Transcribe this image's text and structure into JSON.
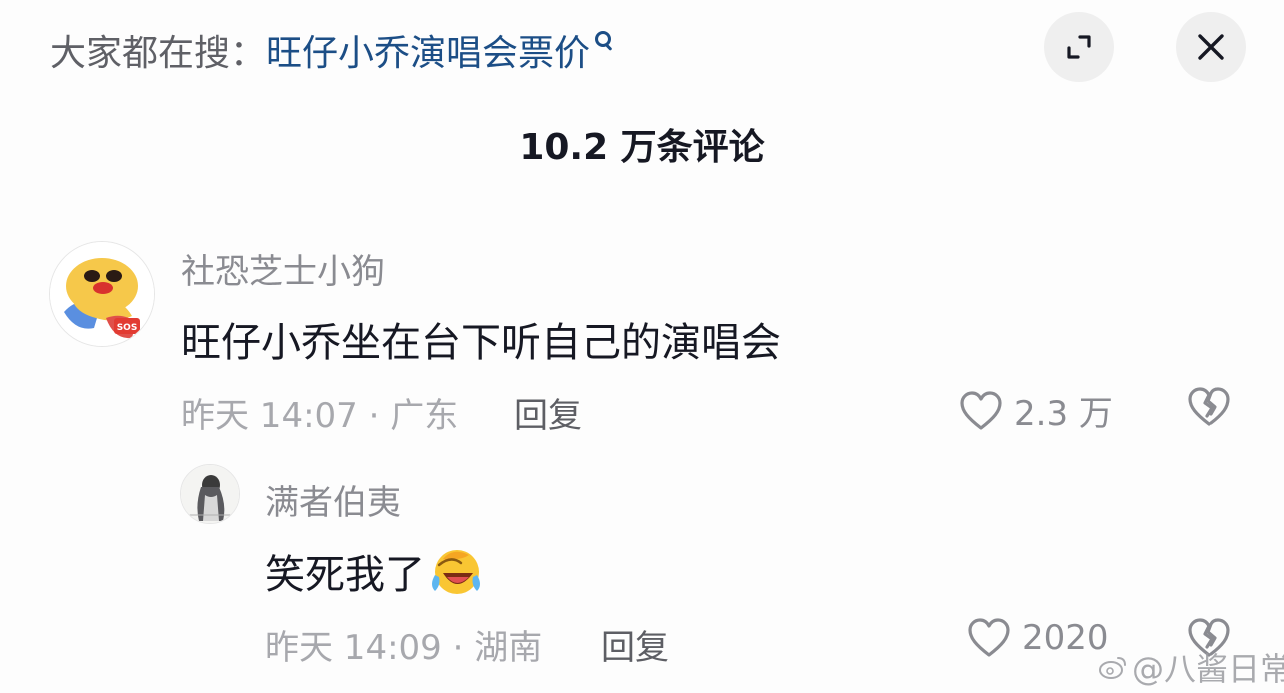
{
  "header": {
    "search_prefix": "大家都在搜：",
    "search_query": "旺仔小乔演唱会票价",
    "expand_icon": "expand-icon",
    "close_icon": "close-icon"
  },
  "comment_count": "10.2 万条评论",
  "comments": [
    {
      "username": "社恐芝士小狗",
      "avatar_badge": "SOS",
      "text": "旺仔小乔坐在台下听自己的演唱会",
      "meta": "昨天 14:07 · 广东",
      "reply_label": "回复",
      "likes": "2.3 万"
    },
    {
      "username": "满者伯夷",
      "text": "笑死我了",
      "emoji": "laughing-crying-emoji",
      "meta": "昨天 14:09 · 湖南",
      "reply_label": "回复",
      "likes": "2020"
    }
  ],
  "watermark": "@八酱日常",
  "colors": {
    "query_link": "#1c4e86",
    "muted": "#8a8b91",
    "text": "#161823",
    "button_bg": "#efefef"
  }
}
